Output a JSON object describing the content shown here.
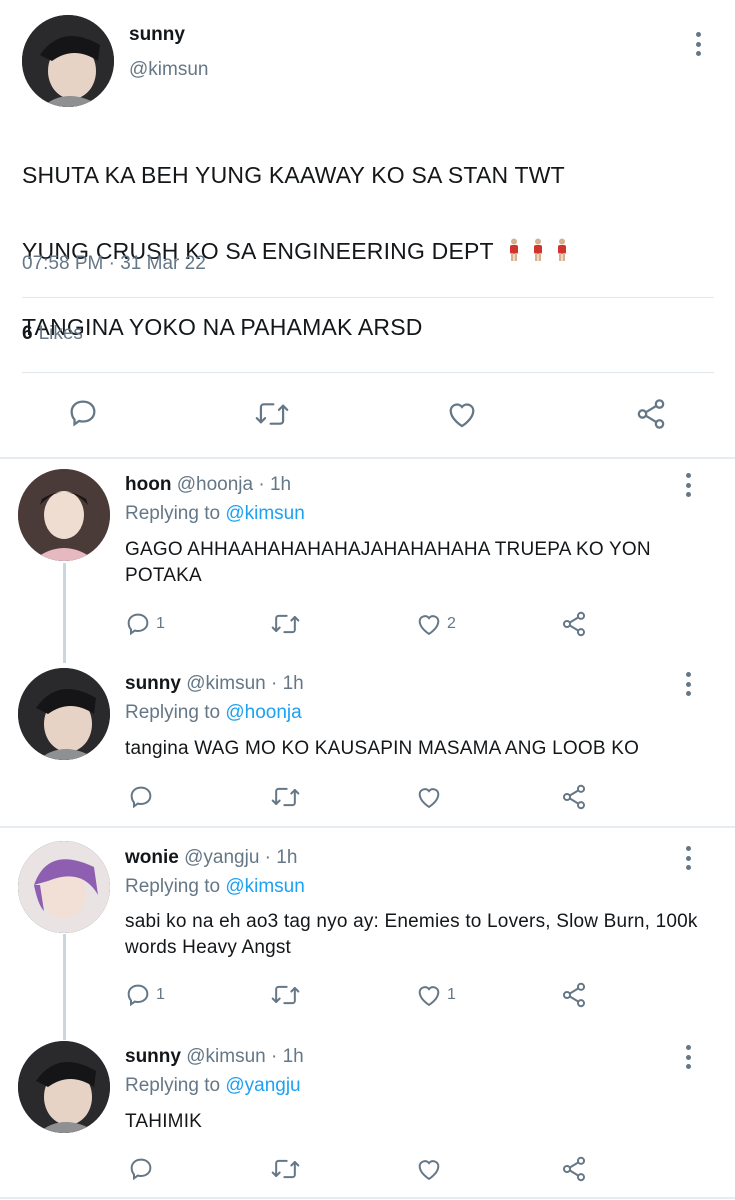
{
  "main_tweet": {
    "name": "sunny",
    "handle": "@kimsun",
    "text_lines": [
      "SHUTA KA BEH YUNG KAAWAY KO SA STAN TWT",
      "YUNG CRUSH KO SA ENGINEERING DEPT",
      "TANGINA YOKO NA PAHAMAK ARSD"
    ],
    "emoji": [
      "man-standing-icon",
      "man-standing-icon",
      "man-standing-icon"
    ],
    "timestamp": "07:58 PM · 31 Mar 22",
    "likes_count": "6",
    "likes_label": "Likes",
    "actions": [
      "reply-icon",
      "retweet-icon",
      "like-icon",
      "share-icon"
    ]
  },
  "replies": [
    {
      "name": "hoon",
      "handle": "@hoonja · 1h",
      "replying_label": "Replying to",
      "replying_to": "@kimsun",
      "text": "GAGO AHHAAHAHAHAHAJAHAHAHAHA TRUEPA KO YON POTAKA",
      "reply_count": "1",
      "retweet_count": "",
      "like_count": "2"
    },
    {
      "name": "sunny",
      "handle": "@kimsun · 1h",
      "replying_label": "Replying to",
      "replying_to": "@hoonja",
      "text": "tangina WAG MO KO KAUSAPIN MASAMA ANG LOOB KO",
      "reply_count": "",
      "retweet_count": "",
      "like_count": ""
    },
    {
      "name": "wonie",
      "handle": "@yangju · 1h",
      "replying_label": "Replying to",
      "replying_to": "@kimsun",
      "text": "sabi ko na eh ao3 tag nyo ay: Enemies to Lovers, Slow Burn, 100k words Heavy Angst",
      "reply_count": "1",
      "retweet_count": "",
      "like_count": "1"
    },
    {
      "name": "sunny",
      "handle": "@kimsun · 1h",
      "replying_label": "Replying to",
      "replying_to": "@yangju",
      "text": "TAHIMIK",
      "reply_count": "",
      "retweet_count": "",
      "like_count": ""
    }
  ],
  "colors": {
    "text": "#14171a",
    "secondary": "#657786",
    "link": "#1da1f2",
    "divider": "#e1e8ed"
  }
}
